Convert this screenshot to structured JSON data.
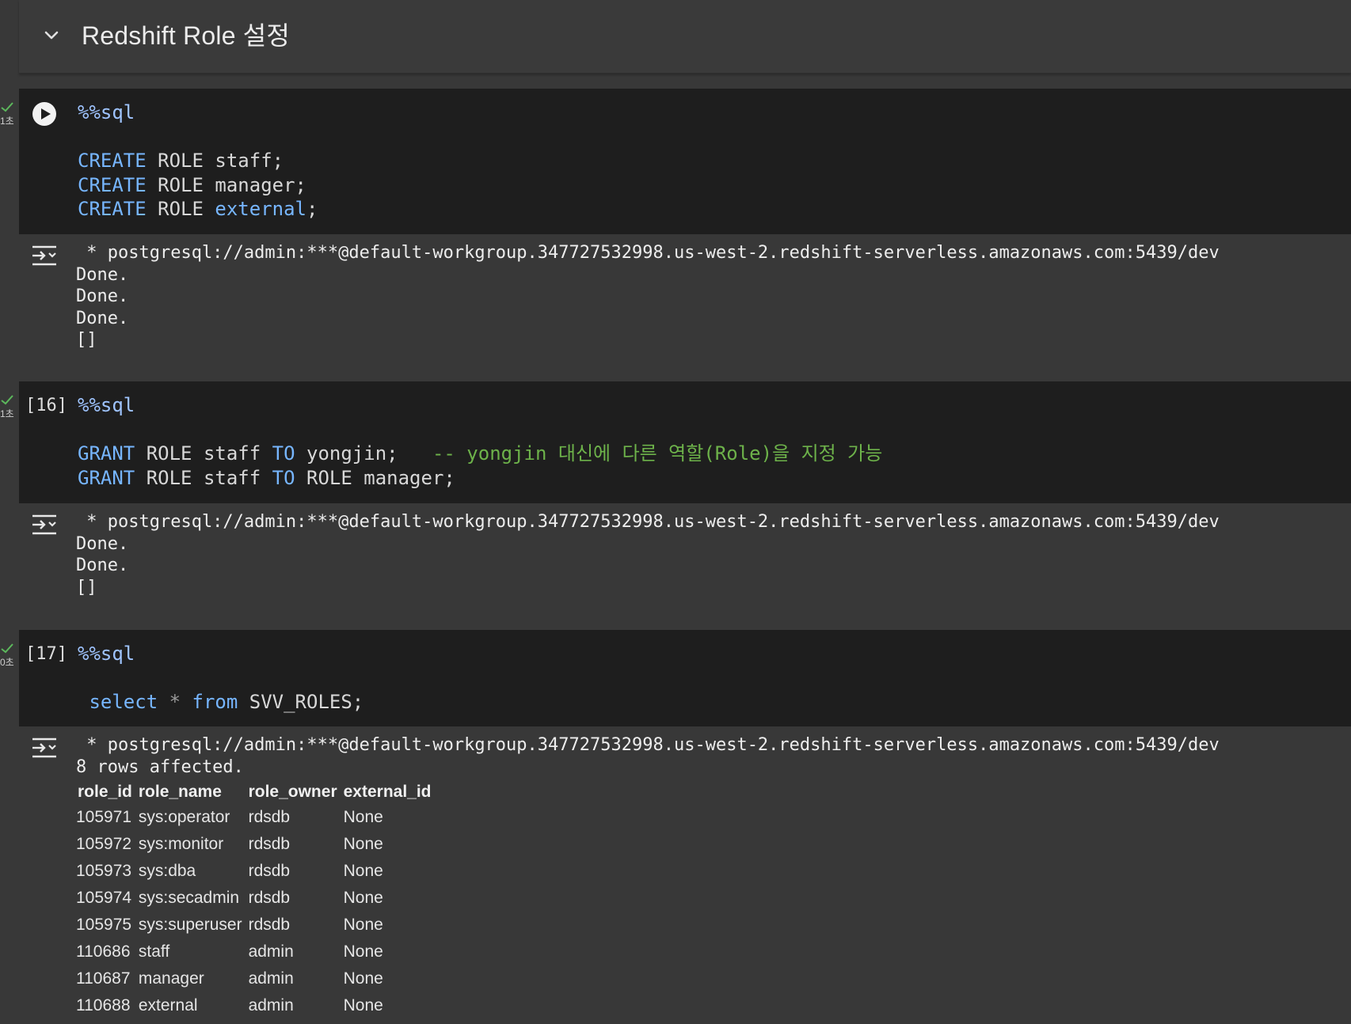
{
  "section": {
    "title": "Redshift Role 설정"
  },
  "cells": [
    {
      "exec_count": "",
      "duration": "1초",
      "code": {
        "magic": "%%sql",
        "lines": [
          {
            "kw": "CREATE",
            "rest": " ROLE staff;"
          },
          {
            "kw": "CREATE",
            "rest": " ROLE manager;"
          },
          {
            "kw": "CREATE",
            "rest": " ROLE ",
            "kw2": "external",
            "rest2": ";"
          }
        ]
      },
      "output": {
        "connection": " * postgresql://admin:***@default-workgroup.347727532998.us-west-2.redshift-serverless.amazonaws.com:5439/dev",
        "lines": [
          "Done.",
          "Done.",
          "Done.",
          "[]"
        ]
      }
    },
    {
      "exec_count": "[16]",
      "duration": "1초",
      "code": {
        "magic": "%%sql",
        "lines": [
          {
            "kw": "GRANT",
            "mid": " ROLE staff ",
            "kw2": "TO",
            "rest": " yongjin;",
            "comment": "   -- yongjin 대신에 다른 역할(Role)을 지정 가능"
          },
          {
            "kw": "GRANT",
            "mid": " ROLE staff ",
            "kw2": "TO",
            "rest": " ROLE manager;"
          }
        ]
      },
      "output": {
        "connection": " * postgresql://admin:***@default-workgroup.347727532998.us-west-2.redshift-serverless.amazonaws.com:5439/dev",
        "lines": [
          "Done.",
          "Done.",
          "[]"
        ]
      }
    },
    {
      "exec_count": "[17]",
      "duration": "0초",
      "code": {
        "magic": "%%sql",
        "lines": [
          {
            "kw": " select",
            "op": " * ",
            "kw2": "from",
            "rest": " SVV_ROLES;"
          }
        ]
      },
      "output": {
        "connection": " * postgresql://admin:***@default-workgroup.347727532998.us-west-2.redshift-serverless.amazonaws.com:5439/dev",
        "lines": [
          "8 rows affected."
        ],
        "table": {
          "headers": [
            "role_id",
            "role_name",
            "role_owner",
            "external_id"
          ],
          "rows": [
            [
              "105971",
              "sys:operator",
              "rdsdb",
              "None"
            ],
            [
              "105972",
              "sys:monitor",
              "rdsdb",
              "None"
            ],
            [
              "105973",
              "sys:dba",
              "rdsdb",
              "None"
            ],
            [
              "105974",
              "sys:secadmin",
              "rdsdb",
              "None"
            ],
            [
              "105975",
              "sys:superuser",
              "rdsdb",
              "None"
            ],
            [
              "110686",
              "staff",
              "admin",
              "None"
            ],
            [
              "110687",
              "manager",
              "admin",
              "None"
            ],
            [
              "110688",
              "external",
              "admin",
              "None"
            ]
          ]
        }
      }
    }
  ],
  "colors": {
    "keyword": "#77b6ff",
    "comment": "#6db24a",
    "code_bg": "#1e1e1e",
    "output_bg": "#383838",
    "status_ok": "#5cb85c"
  }
}
